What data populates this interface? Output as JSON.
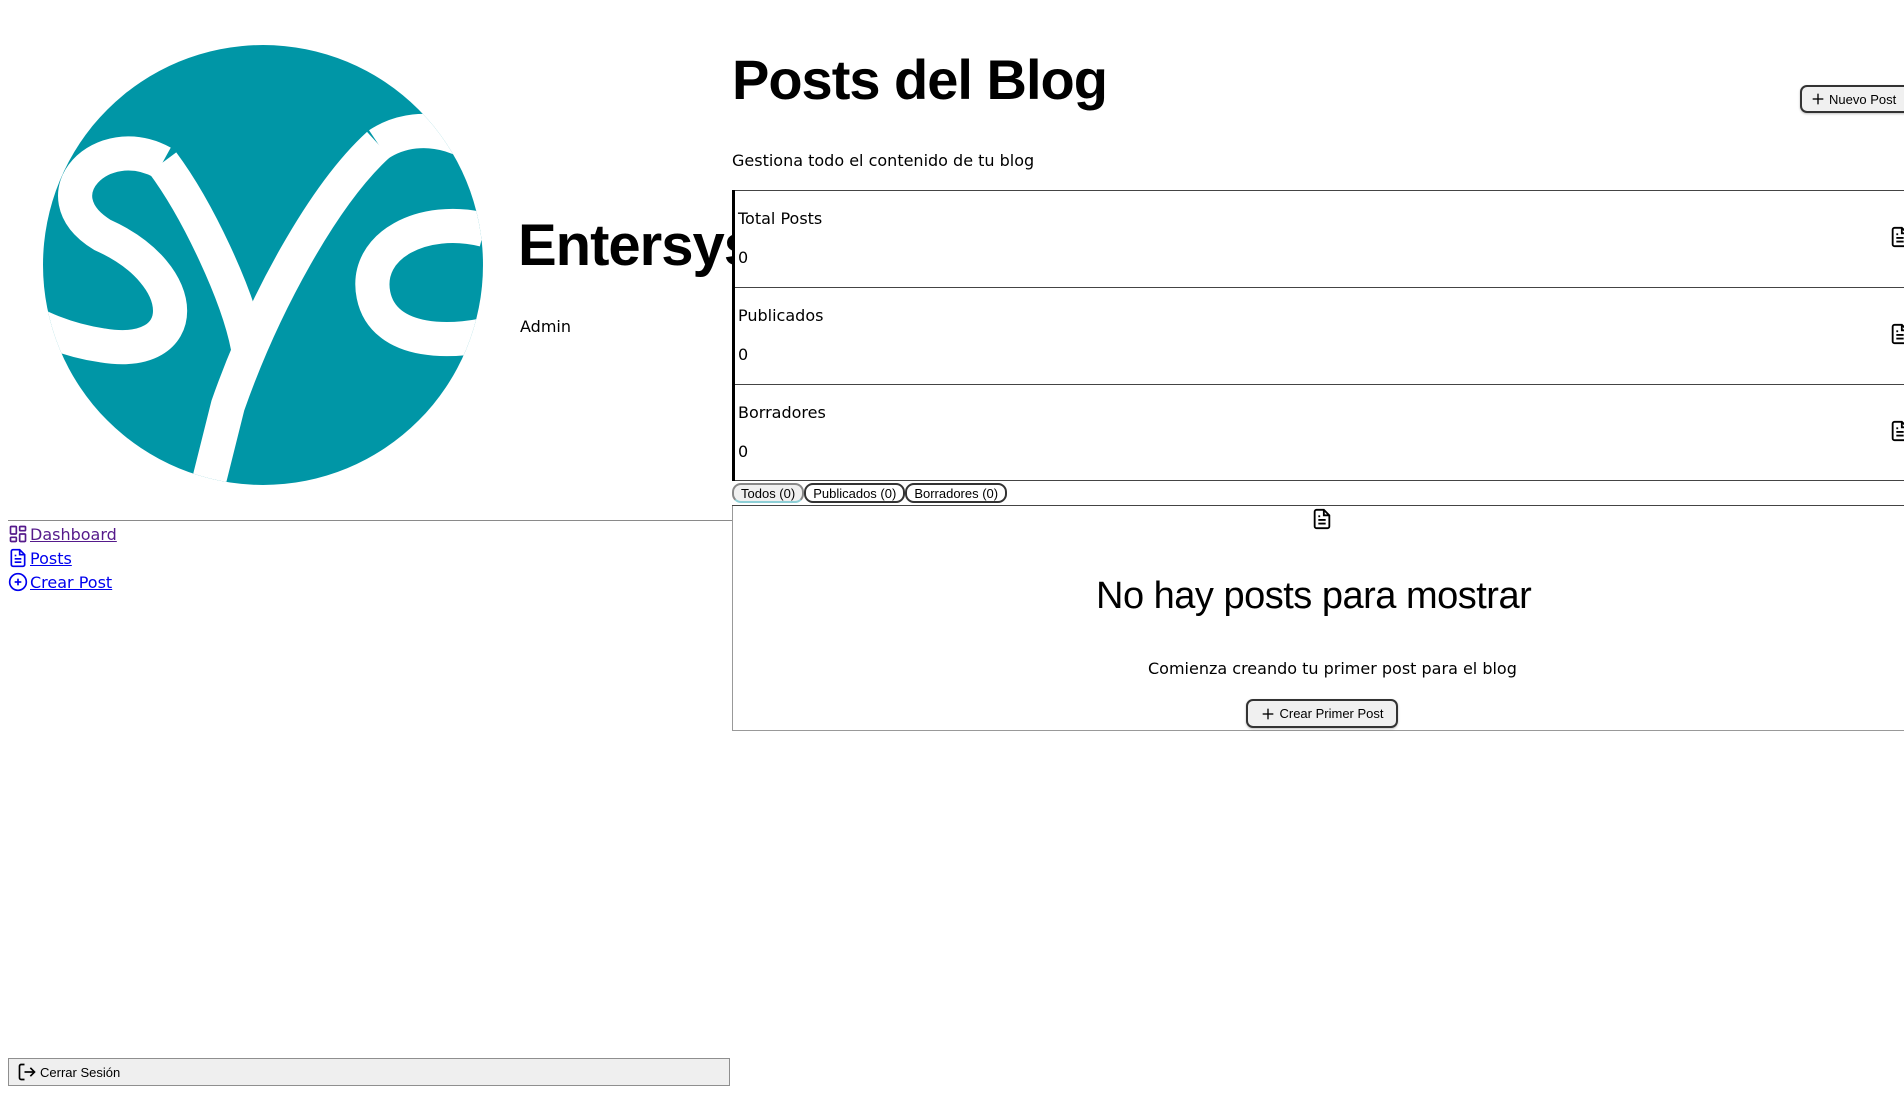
{
  "sidebar": {
    "brand_name": "Entersys",
    "brand_role": "Admin",
    "logo_color": "#0096a6",
    "nav": [
      {
        "label": "Dashboard",
        "icon": "dashboard-grid-icon"
      },
      {
        "label": "Posts",
        "icon": "document-icon"
      },
      {
        "label": "Crear Post",
        "icon": "plus-circle-icon"
      }
    ],
    "logout_label": "Cerrar Sesión"
  },
  "header": {
    "title": "Posts del Blog",
    "subtitle": "Gestiona todo el contenido de tu blog",
    "new_post_label": "Nuevo Post"
  },
  "stats": [
    {
      "label": "Total Posts",
      "value": "0",
      "icon": "document-icon"
    },
    {
      "label": "Publicados",
      "value": "0",
      "icon": "document-icon"
    },
    {
      "label": "Borradores",
      "value": "0",
      "icon": "document-icon"
    }
  ],
  "tabs": [
    {
      "label": "Todos (0)",
      "active": true
    },
    {
      "label": "Publicados (0)",
      "active": false
    },
    {
      "label": "Borradores (0)",
      "active": false
    }
  ],
  "empty_state": {
    "title": "No hay posts para mostrar",
    "description": "Comienza creando tu primer post para el blog",
    "cta_label": "Crear Primer Post"
  }
}
